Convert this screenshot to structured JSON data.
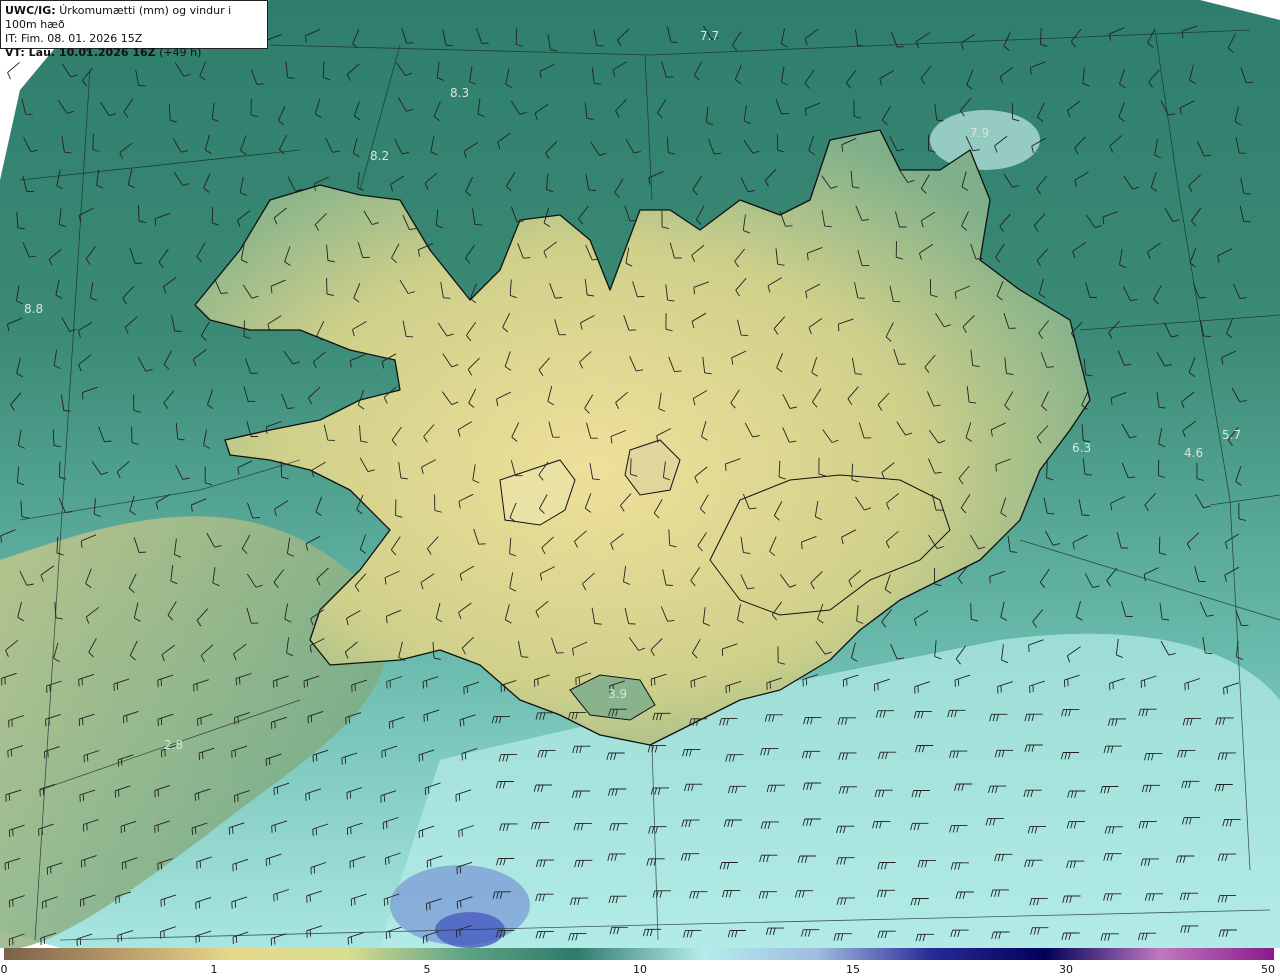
{
  "header": {
    "model": "UWC/IG:",
    "product": "Úrkomumætti (mm) og vindur i 100m hæð",
    "issue_time": "IT: Fim. 08. 01. 2026 15Z",
    "valid_time_bold": "VT: Lau. 10.01.2026 16Z",
    "valid_time_offset": "(+49 h)"
  },
  "colorbar": {
    "ticks": [
      "0",
      "1",
      "5",
      "10",
      "15",
      "30",
      "50"
    ],
    "colors": [
      "#7a6248",
      "#b89a68",
      "#e6d88a",
      "#d9dd8f",
      "#5fa585",
      "#2f7a6b",
      "#b4ecec",
      "#9fbde0",
      "#2a2a98",
      "#00005a",
      "#c078c0",
      "#8a1a8a"
    ]
  },
  "annotations": [
    {
      "id": "val-7-7",
      "text": "7.7"
    },
    {
      "id": "val-8-3",
      "text": "8.3"
    },
    {
      "id": "val-8-2",
      "text": "8.2"
    },
    {
      "id": "val-7-9",
      "text": "7.9"
    },
    {
      "id": "val-8-8",
      "text": "8.8"
    },
    {
      "id": "val-6-3",
      "text": "6.3"
    },
    {
      "id": "val-4-6",
      "text": "4.6"
    },
    {
      "id": "val-5-7",
      "text": "5.7"
    },
    {
      "id": "val-3-9",
      "text": "3.9"
    },
    {
      "id": "val-2-8",
      "text": "2.8"
    }
  ],
  "map": {
    "background_color": "#2f7a6b",
    "land_color": "#e6d88a",
    "grid_color": "#1a2a28"
  }
}
